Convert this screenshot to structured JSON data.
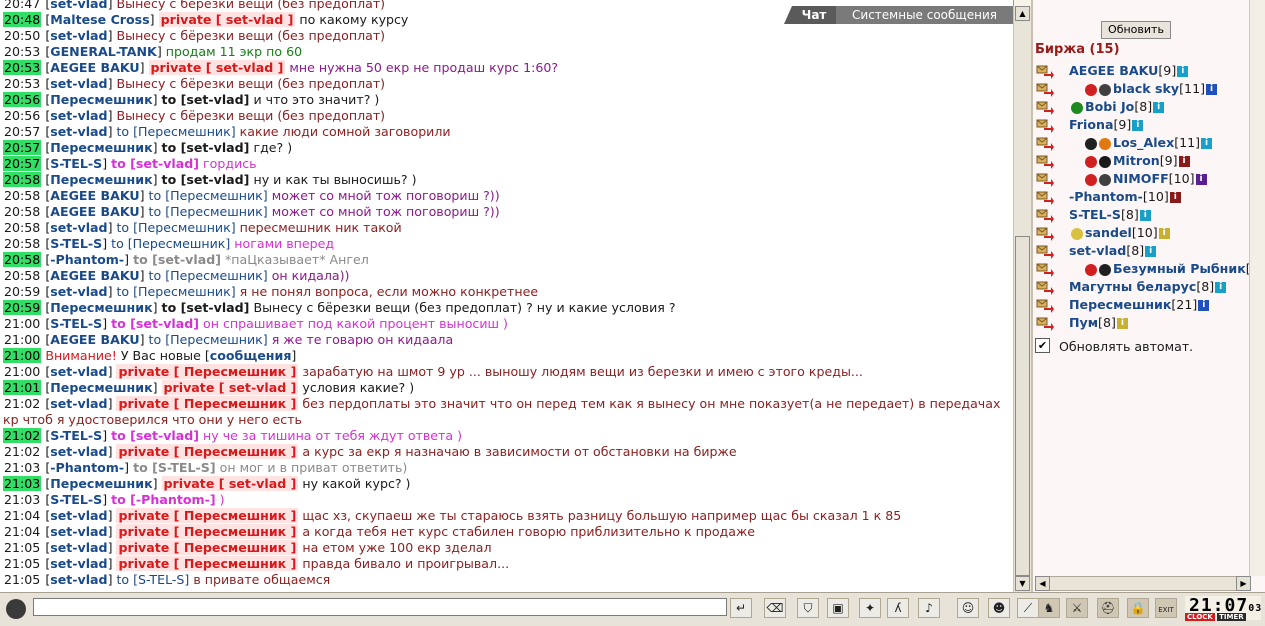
{
  "chat": {
    "tabs": {
      "chat": "Чат",
      "system": "Системные сообщения"
    },
    "lines": [
      {
        "ts": "20:47",
        "hl": false,
        "nick": "set-vlad",
        "tag": "",
        "text": "Вынесу с бёрезки вещи (без предоплат)",
        "tc": "c-maroon"
      },
      {
        "ts": "20:48",
        "hl": true,
        "nick": "Maltese Cross",
        "tag": "private [ set-vlad ]",
        "tagtype": "private",
        "text": "по какому курсу",
        "tc": "c-dark"
      },
      {
        "ts": "20:50",
        "hl": false,
        "nick": "set-vlad",
        "tag": "",
        "text": "Вынесу с бёрезки вещи (без предоплат)",
        "tc": "c-maroon"
      },
      {
        "ts": "20:53",
        "hl": false,
        "nick": "GENERAL-TANK",
        "tag": "",
        "text": "продам 11 экр по 60",
        "tc": "c-green"
      },
      {
        "ts": "20:53",
        "hl": true,
        "nick": "AEGEE BAKU",
        "tag": "private [ set-vlad ]",
        "tagtype": "private",
        "text": "мне нужна 50 екр не продаш курс 1:60?",
        "tc": "c-purple"
      },
      {
        "ts": "20:53",
        "hl": false,
        "nick": "set-vlad",
        "tag": "",
        "text": "Вынесу с бёрезки вещи (без предоплат)",
        "tc": "c-maroon"
      },
      {
        "ts": "20:56",
        "hl": true,
        "nick": "Пересмешник",
        "tag": "to [set-vlad]",
        "tagtype": "to-dark",
        "text": "и что это значит? )",
        "tc": "c-dark"
      },
      {
        "ts": "20:56",
        "hl": false,
        "nick": "set-vlad",
        "tag": "",
        "text": "Вынесу с бёрезки вещи (без предоплат)",
        "tc": "c-maroon"
      },
      {
        "ts": "20:57",
        "hl": false,
        "nick": "set-vlad",
        "tag": "to [Пересмешник]",
        "tagtype": "to-blue",
        "text": "какие люди сомной заговорили",
        "tc": "c-maroon"
      },
      {
        "ts": "20:57",
        "hl": true,
        "nick": "Пересмешник",
        "tag": "to [set-vlad]",
        "tagtype": "to-dark",
        "text": "где? )",
        "tc": "c-dark"
      },
      {
        "ts": "20:57",
        "hl": true,
        "nick": "S-TEL-S",
        "tag": "to [set-vlad]",
        "tagtype": "to-pink",
        "text": "гордись",
        "tc": "c-pink"
      },
      {
        "ts": "20:58",
        "hl": true,
        "nick": "Пересмешник",
        "tag": "to [set-vlad]",
        "tagtype": "to-dark",
        "text": "ну и как ты выносишь? )",
        "tc": "c-dark"
      },
      {
        "ts": "20:58",
        "hl": false,
        "nick": "AEGEE BAKU",
        "tag": "to [Пересмешник]",
        "tagtype": "to-blue",
        "text": "может со мной тож поговориш ?))",
        "tc": "c-purple"
      },
      {
        "ts": "20:58",
        "hl": false,
        "nick": "AEGEE BAKU",
        "tag": "to [Пересмешник]",
        "tagtype": "to-blue",
        "text": "может со мной тож поговориш ?))",
        "tc": "c-purple"
      },
      {
        "ts": "20:58",
        "hl": false,
        "nick": "set-vlad",
        "tag": "to [Пересмешник]",
        "tagtype": "to-blue",
        "text": "пересмешник ник такой",
        "tc": "c-maroon"
      },
      {
        "ts": "20:58",
        "hl": false,
        "nick": "S-TEL-S",
        "tag": "to [Пересмешник]",
        "tagtype": "to-blue",
        "text": "ногами вперед",
        "tc": "c-pink"
      },
      {
        "ts": "20:58",
        "hl": true,
        "nick": "-Phantom-",
        "tag": "to [set-vlad]",
        "tagtype": "to-gray",
        "text": "*паЦказывает* Ангел",
        "tc": "c-gray"
      },
      {
        "ts": "20:58",
        "hl": false,
        "nick": "AEGEE BAKU",
        "tag": "to [Пересмешник]",
        "tagtype": "to-blue",
        "text": "он кидала))",
        "tc": "c-purple"
      },
      {
        "ts": "20:59",
        "hl": false,
        "nick": "set-vlad",
        "tag": "to [Пересмешник]",
        "tagtype": "to-blue",
        "text": "я не понял вопроса, если можно конкретнее",
        "tc": "c-maroon"
      },
      {
        "ts": "20:59",
        "hl": true,
        "nick": "Пересмешник",
        "tag": "to [set-vlad]",
        "tagtype": "to-dark",
        "text": "Вынесу с бёрезки вещи (без предоплат) ? ну и какие условия ?",
        "tc": "c-dark"
      },
      {
        "ts": "21:00",
        "hl": false,
        "nick": "S-TEL-S",
        "tag": "to [set-vlad]",
        "tagtype": "to-pink",
        "text": "он спрашивает под какой процент выносиш )",
        "tc": "c-pink"
      },
      {
        "ts": "21:00",
        "hl": false,
        "nick": "AEGEE BAKU",
        "tag": "to [Пересмешник]",
        "tagtype": "to-blue",
        "text": "я же те говарю он кидаала",
        "tc": "c-purple"
      },
      {
        "ts": "21:00",
        "hl": true,
        "system": true,
        "alert": "Внимание!",
        "text1": "У Вас новые",
        "link": "сообщения"
      },
      {
        "ts": "21:00",
        "hl": false,
        "nick": "set-vlad",
        "tag": "private [ Пересмешник ]",
        "tagtype": "private",
        "text": "зарабатую на шмот 9 ур ... выношу людям вещи из березки и имею с этого креды...",
        "tc": "c-maroon"
      },
      {
        "ts": "21:01",
        "hl": true,
        "nick": "Пересмешник",
        "tag": "private [ set-vlad ]",
        "tagtype": "private",
        "text": "условия какие? )",
        "tc": "c-dark"
      },
      {
        "ts": "21:02",
        "hl": false,
        "nick": "set-vlad",
        "tag": "private [ Пересмешник ]",
        "tagtype": "private",
        "text": "без пердоплаты это значит что он перед тем как я вынесу он мне показует(а не передает) в передачах кр чтоб я удостоверился что они у него есть",
        "tc": "c-maroon"
      },
      {
        "ts": "21:02",
        "hl": true,
        "nick": "S-TEL-S",
        "tag": "to [set-vlad]",
        "tagtype": "to-pink",
        "text": "ну че за тишина от тебя ждут ответа )",
        "tc": "c-pink"
      },
      {
        "ts": "21:02",
        "hl": false,
        "nick": "set-vlad",
        "tag": "private [ Пересмешник ]",
        "tagtype": "private",
        "text": "а курс за екр я назначаю в зависимости от обстановки на бирже",
        "tc": "c-maroon"
      },
      {
        "ts": "21:03",
        "hl": false,
        "nick": "-Phantom-",
        "tag": "to [S-TEL-S]",
        "tagtype": "to-gray",
        "text": "он мог и в приват ответить)",
        "tc": "c-gray"
      },
      {
        "ts": "21:03",
        "hl": true,
        "nick": "Пересмешник",
        "tag": "private [ set-vlad ]",
        "tagtype": "private",
        "text": "ну какой курс? )",
        "tc": "c-dark"
      },
      {
        "ts": "21:03",
        "hl": false,
        "nick": "S-TEL-S",
        "tag": "to [-Phantom-]",
        "tagtype": "to-pink",
        "text": ")",
        "tc": "c-pink"
      },
      {
        "ts": "21:04",
        "hl": false,
        "nick": "set-vlad",
        "tag": "private [ Пересмешник ]",
        "tagtype": "private",
        "text": "щас хз, скупаеш же ты стараюсь взять разницу большую например щас бы сказал 1 к 85",
        "tc": "c-maroon"
      },
      {
        "ts": "21:04",
        "hl": false,
        "nick": "set-vlad",
        "tag": "private [ Пересмешник ]",
        "tagtype": "private",
        "text": "а когда тебя нет курс стабилен говорю приблизительно к продаже",
        "tc": "c-maroon"
      },
      {
        "ts": "21:05",
        "hl": false,
        "nick": "set-vlad",
        "tag": "private [ Пересмешник ]",
        "tagtype": "private",
        "text": "на етом уже 100 екр зделал",
        "tc": "c-maroon"
      },
      {
        "ts": "21:05",
        "hl": false,
        "nick": "set-vlad",
        "tag": "private [ Пересмешник ]",
        "tagtype": "private",
        "text": "правда бивало и проигрывал...",
        "tc": "c-maroon"
      },
      {
        "ts": "21:05",
        "hl": false,
        "nick": "set-vlad",
        "tag": "to [S-TEL-S]",
        "tagtype": "to-blue",
        "text": "в привате общаемся",
        "tc": "c-maroon"
      }
    ]
  },
  "right_panel": {
    "refresh_label": "Обновить",
    "exchange_title": "Биржа (15)",
    "auto_refresh_label": "Обновлять автомат.",
    "users": [
      {
        "name": "AEGEE BAKU",
        "level": "[9]",
        "info_color": "#19a0c8",
        "badges": []
      },
      {
        "name": "black sky",
        "level": "[11]",
        "info_color": "#2050c0",
        "badges": [
          "#d02020",
          "#404040"
        ]
      },
      {
        "name": "Bobi Jo",
        "level": "[8]",
        "info_color": "#19a0c8",
        "badges": [
          "#1f8a1f"
        ]
      },
      {
        "name": "Friona",
        "level": "[9]",
        "info_color": "#19a0c8",
        "badges": []
      },
      {
        "name": "Los_Alex",
        "level": "[11]",
        "info_color": "#19a0c8",
        "badges": [
          "#202020",
          "#e07a10"
        ]
      },
      {
        "name": "Mitron",
        "level": "[9]",
        "info_color": "#8a1a1a",
        "badges": [
          "#d02020",
          "#1a1a1a"
        ]
      },
      {
        "name": "NIMOFF",
        "level": "[10]",
        "info_color": "#5a2090",
        "badges": [
          "#d02020",
          "#404040"
        ]
      },
      {
        "name": "-Phantom-",
        "level": "[10]",
        "info_color": "#8a1a1a",
        "badges": []
      },
      {
        "name": "S-TEL-S",
        "level": "[8]",
        "info_color": "#19a0c8",
        "badges": []
      },
      {
        "name": "sandel",
        "level": "[10]",
        "info_color": "#c8b030",
        "badges": [
          "#d8c040"
        ]
      },
      {
        "name": "set-vlad",
        "level": "[8]",
        "info_color": "#19a0c8",
        "badges": []
      },
      {
        "name": "Безумный Рыбник",
        "level": "[8]",
        "info_color": "#19a0c8",
        "badges": [
          "#d02020",
          "#202020"
        ]
      },
      {
        "name": "Магутны беларус",
        "level": "[8]",
        "info_color": "#19a0c8",
        "badges": []
      },
      {
        "name": "Пересмешник",
        "level": "[21]",
        "info_color": "#2050c0",
        "badges": []
      },
      {
        "name": "Пум",
        "level": "[8]",
        "info_color": "#c8b030",
        "badges": []
      }
    ]
  },
  "bottom": {
    "clock": "21:07",
    "clock_seconds": "03",
    "clock_label": "CLOCK",
    "timer_label": "TIMER",
    "exit_label": "EXIT",
    "tools": [
      "send-icon",
      "eraser-icon",
      "filter-icon",
      "save-icon",
      "run-icon",
      "translit-icon",
      "music-icon",
      "smiley-icon",
      "emotes-icon",
      "arrow-icon"
    ],
    "game_tools": [
      "bag-icon",
      "sword-icon",
      "helmet-icon",
      "lock-icon",
      "exit-icon"
    ]
  }
}
